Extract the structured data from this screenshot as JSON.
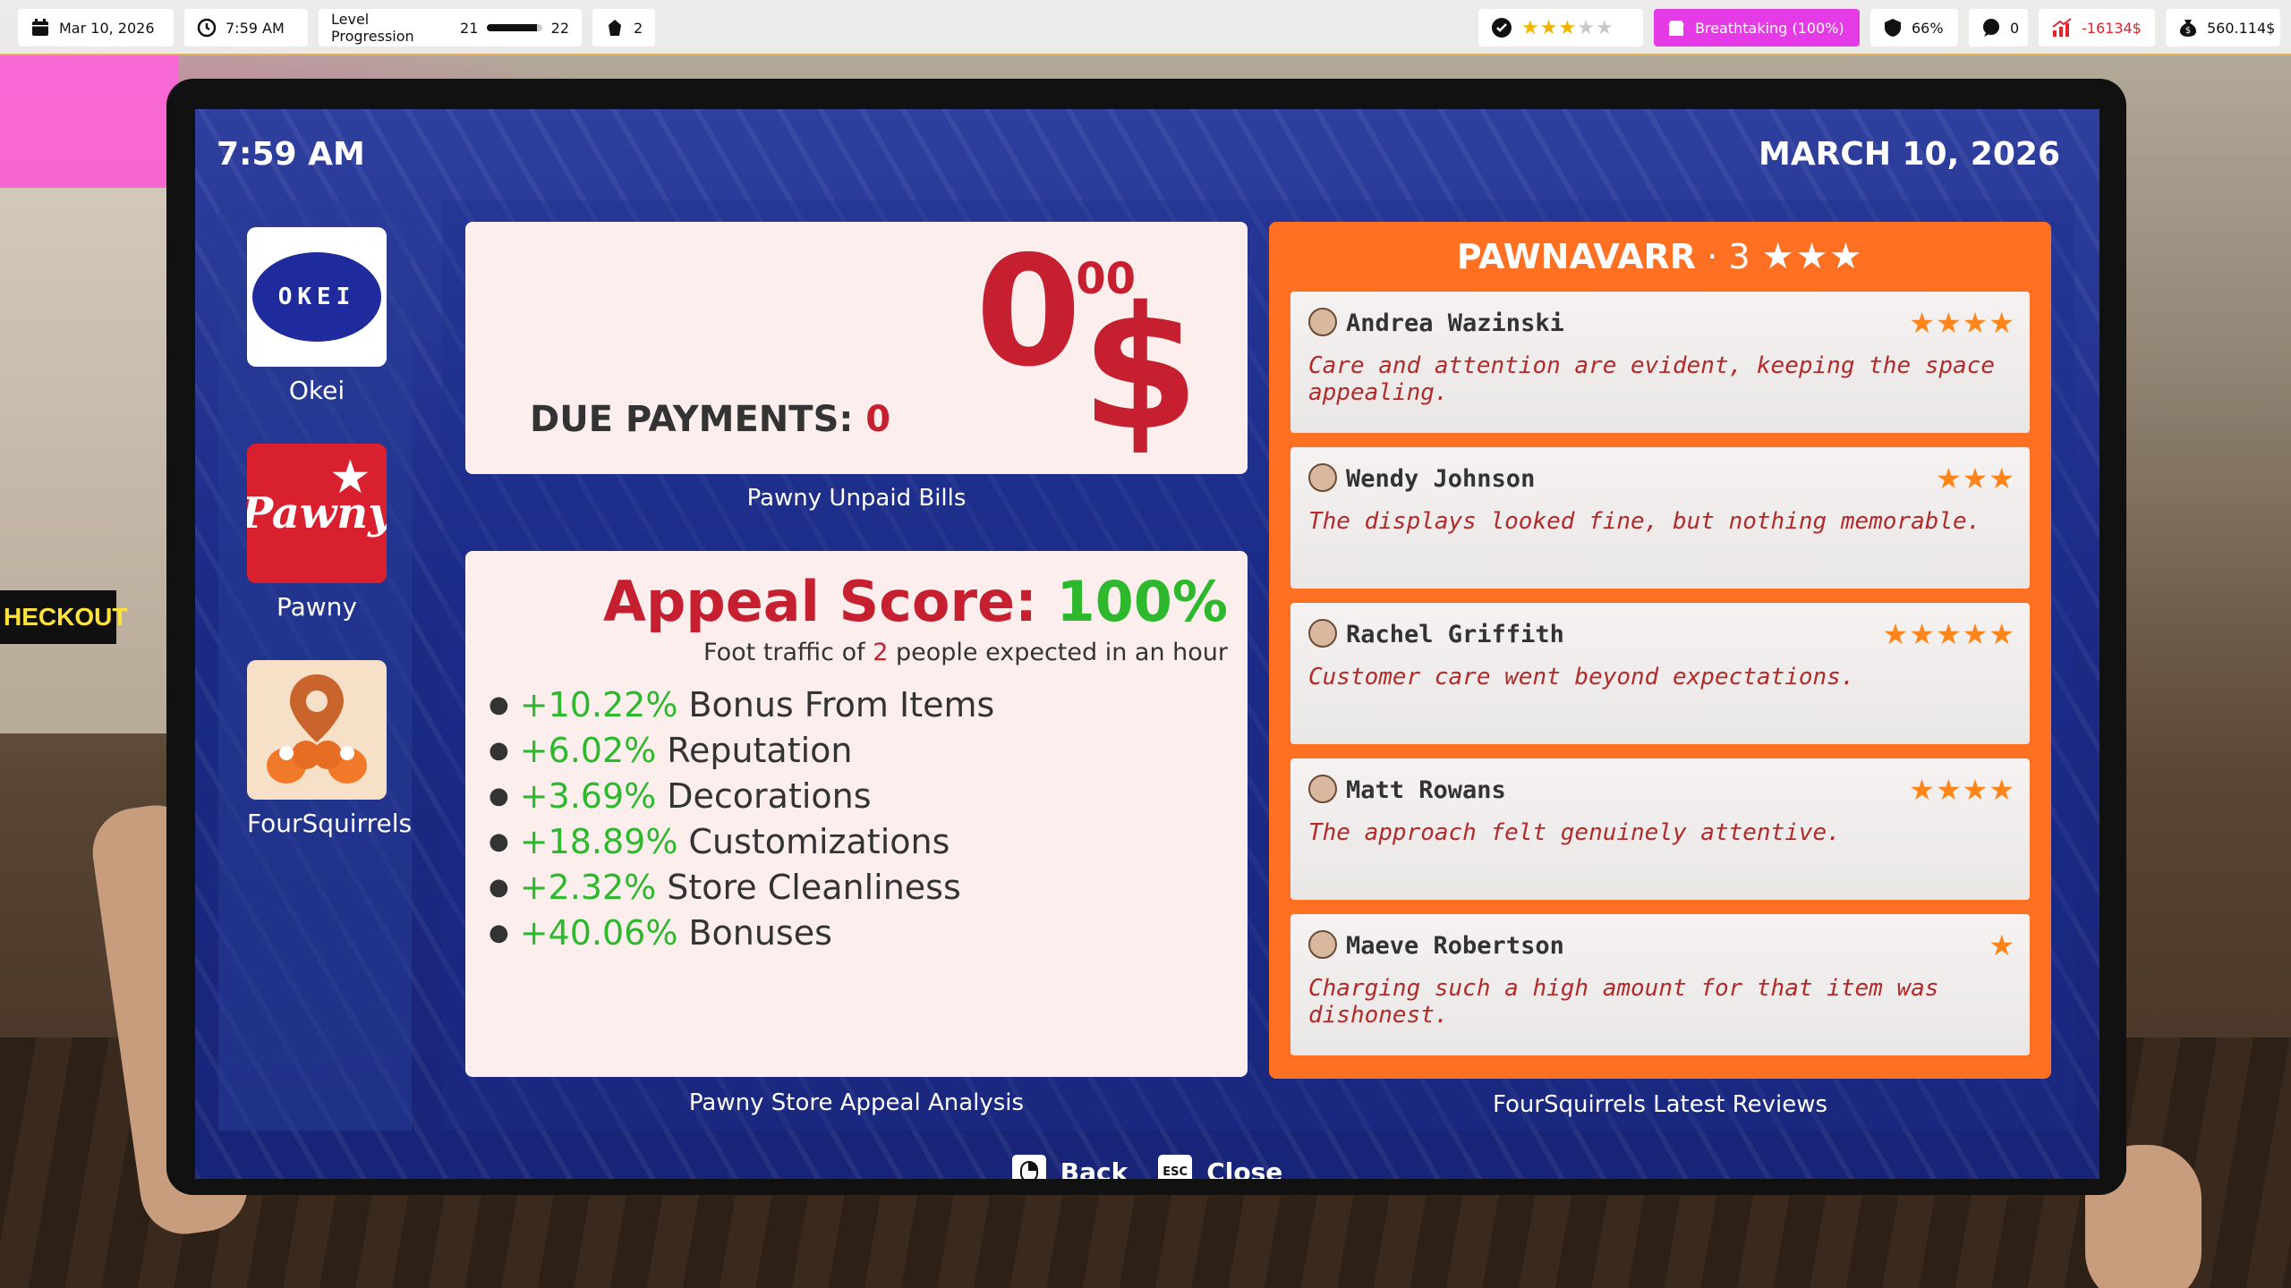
{
  "hud": {
    "date": "Mar 10, 2026",
    "time": "7:59 AM",
    "level_label": "Level Progression",
    "level_from": "21",
    "level_to": "22",
    "level_progress": 0.9,
    "items_count": "2",
    "rating_stars": 3,
    "rating_max": 5,
    "status_badge": "Breathtaking (100%)",
    "security_pct": "66%",
    "notifications": "0",
    "daily_change": "-16134$",
    "money": "560.114$"
  },
  "screen": {
    "time": "7:59 AM",
    "date": "MARCH 10, 2026"
  },
  "apps": [
    {
      "label": "Okei",
      "logo_text": "OKEI",
      "icon": "okei-logo-icon"
    },
    {
      "label": "Pawny",
      "logo_text": "Pawny",
      "icon": "pawny-logo-icon"
    },
    {
      "label": "FourSquirrels",
      "icon": "foursquirrels-logo-icon"
    }
  ],
  "bills": {
    "amount_whole": "0",
    "amount_cents": ".00",
    "currency": "$",
    "due_label": "DUE PAYMENTS: ",
    "due_value": "0",
    "caption": "Pawny Unpaid Bills"
  },
  "appeal": {
    "title": "Appeal Score: ",
    "score": "100%",
    "sub_prefix": "Foot traffic of ",
    "sub_count": "2",
    "sub_suffix": " people expected in an hour",
    "caption": "Pawny Store Appeal Analysis",
    "items": [
      {
        "pct": "+10.22%",
        "label": "Bonus From Items"
      },
      {
        "pct": "+6.02%",
        "label": "Reputation"
      },
      {
        "pct": "+3.69%",
        "label": "Decorations"
      },
      {
        "pct": "+18.89%",
        "label": "Customizations"
      },
      {
        "pct": "+2.32%",
        "label": "Store Cleanliness"
      },
      {
        "pct": "+40.06%",
        "label": "Bonuses"
      }
    ]
  },
  "reviews": {
    "store_name": "PAWNAVARR",
    "separator": " · ",
    "store_rating": "3",
    "caption": "FourSquirrels Latest Reviews",
    "items": [
      {
        "name": "Andrea Wazinski",
        "stars": 4,
        "text": "Care and attention are evident, keeping the space appealing."
      },
      {
        "name": "Wendy Johnson",
        "stars": 3,
        "text": "The displays looked fine, but nothing memorable."
      },
      {
        "name": "Rachel Griffith",
        "stars": 5,
        "text": "Customer care went beyond expectations."
      },
      {
        "name": "Matt Rowans",
        "stars": 4,
        "text": "The approach felt genuinely attentive."
      },
      {
        "name": "Maeve Robertson",
        "stars": 1,
        "text": "Charging such a high amount for that item was dishonest."
      }
    ]
  },
  "footer": {
    "back_label": "Back",
    "close_label": "Close",
    "close_key": "ESC"
  },
  "background": {
    "checkout_text": "HECKOUT"
  },
  "colors": {
    "accent_red": "#c51f30",
    "accent_green": "#2db82d",
    "reviews_orange": "#ff7023",
    "star_orange": "#ff8419",
    "status_magenta": "#e53be6"
  }
}
